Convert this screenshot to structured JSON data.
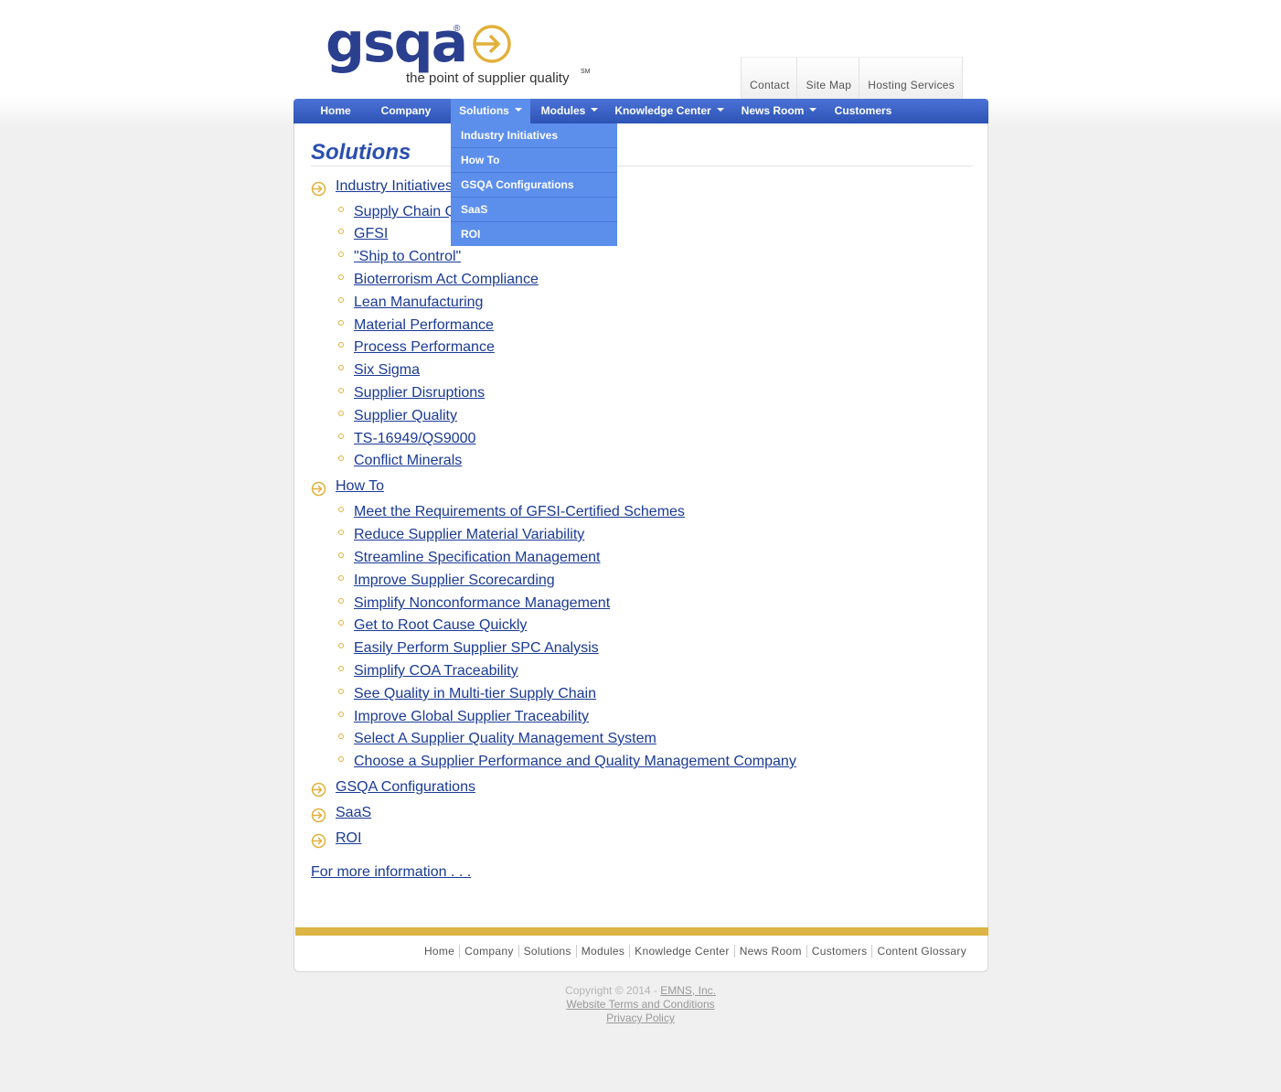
{
  "logo": {
    "word": "gsqa",
    "registered": "®",
    "tagline": "the point of supplier quality",
    "servicemark": "SM",
    "colors": {
      "blue": "#2b3f8f",
      "gold": "#e2b13c"
    }
  },
  "utility_nav": [
    "Contact",
    "Site Map",
    "Hosting Services"
  ],
  "main_nav": [
    {
      "label": "Home",
      "has_caret": false
    },
    {
      "label": "Company",
      "has_caret": false
    },
    {
      "label": "Solutions",
      "has_caret": true,
      "active": true
    },
    {
      "label": "Modules",
      "has_caret": true
    },
    {
      "label": "Knowledge Center",
      "has_caret": true
    },
    {
      "label": "News Room",
      "has_caret": true
    },
    {
      "label": "Customers",
      "has_caret": false
    }
  ],
  "dropdown": [
    "Industry Initiatives",
    "How To",
    "GSQA Configurations",
    "SaaS",
    "ROI"
  ],
  "page_title": "Solutions",
  "sections": [
    {
      "label": "Industry Initiatives",
      "children": [
        "Supply Chain Q",
        "GFSI",
        "\"Ship to Control\"",
        "Bioterrorism Act Compliance",
        "Lean Manufacturing",
        "Material Performance",
        "Process Performance",
        "Six Sigma",
        "Supplier Disruptions",
        "Supplier Quality",
        "TS-16949/QS9000",
        "Conflict Minerals"
      ]
    },
    {
      "label": "How To",
      "children": [
        "Meet the Requirements of GFSI-Certified Schemes",
        "Reduce Supplier Material Variability",
        "Streamline Specification Management",
        "Improve Supplier Scorecarding",
        "Simplify Nonconformance Management",
        "Get to Root Cause Quickly",
        "Easily Perform Supplier SPC Analysis",
        "Simplify COA Traceability",
        "See Quality in Multi-tier Supply Chain",
        "Improve Global Supplier Traceability",
        "Select A Supplier Quality Management System",
        "Choose a Supplier Performance and Quality Management Company"
      ]
    },
    {
      "label": "GSQA Configurations",
      "children": []
    },
    {
      "label": "SaaS",
      "children": []
    },
    {
      "label": "ROI",
      "children": []
    }
  ],
  "more_info": "For more information . . .",
  "footer_links": [
    "Home",
    "Company",
    "Solutions",
    "Modules",
    "Knowledge Center",
    "News Room",
    "Customers",
    "Content Glossary"
  ],
  "copyright": {
    "prefix": "Copyright © 2014 - ",
    "company": "EMNS, Inc.",
    "terms": "Website Terms and Conditions",
    "privacy": "Privacy Policy"
  },
  "colors": {
    "nav_blue": "#2d53b5",
    "active_blue": "#5c8eec",
    "link": "#1a3a94",
    "gold_bar": "#dcb544"
  }
}
